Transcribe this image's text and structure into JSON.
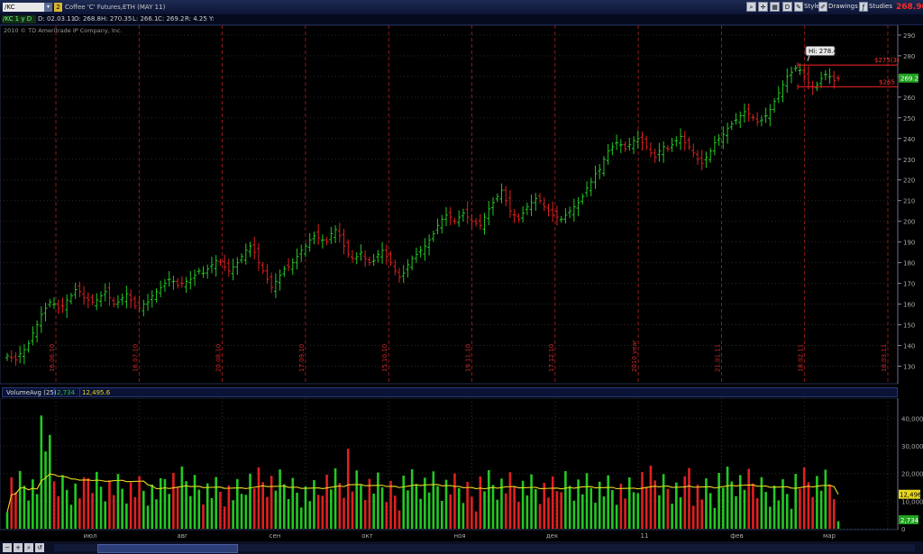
{
  "header": {
    "symbol": "/KC",
    "symbol_dropdown_glyph": "▾",
    "link_number": "2",
    "description": "Coffee 'C' Futures,ETH (MAY 11)",
    "last_price": "268.90",
    "timeframe": "D",
    "toolbar": {
      "style_label": "Style",
      "drawings_label": "Drawings",
      "studies_label": "Studies"
    }
  },
  "quote_info": {
    "label": "/KC 1 y D",
    "date": "D: 02.03.11",
    "open": "O: 268.8",
    "high": "H: 270.35",
    "low": "L: 266.1",
    "close": "C: 269.2",
    "range": "R: 4.25",
    "y": "Y:"
  },
  "copyright": "2010 © TD Ameritrade IP Company, Inc.",
  "annotations": {
    "hi_label": "Hi: 278.4",
    "line1_label": "$275(3)",
    "line2_label": "$265",
    "current_price_label": "269.2"
  },
  "volume_study": {
    "label": "VolumeAvg (25)",
    "value": "2,734",
    "avg": "12,495.6",
    "current_avg_label": "12,496",
    "current_vol_label": "2,734"
  },
  "colors": {
    "up": "#23c823",
    "down": "#e02020",
    "avg": "#e8d820",
    "line": "#e02020",
    "bg": "#000000"
  },
  "chart_data": [
    {
      "type": "candlestick",
      "title": "Coffee 'C' Futures,ETH (MAY 11)",
      "y_ticks": [
        130,
        140,
        150,
        160,
        170,
        180,
        190,
        200,
        210,
        220,
        230,
        240,
        250,
        260,
        270,
        280,
        290
      ],
      "ylim": [
        125,
        293
      ],
      "x_month_labels": [
        "июл",
        "авг",
        "сен",
        "окт",
        "ноя",
        "дек",
        "11",
        "фев",
        "мар"
      ],
      "vertical_date_labels": [
        "16.06.10",
        "16.07.10",
        "20.08.10",
        "17.09.10",
        "15.10.10",
        "19.11.10",
        "17.12.10",
        "2010 year",
        "21.01.11",
        "18.02.11",
        "18.03.11"
      ],
      "horizontal_lines": [
        275.5,
        265
      ],
      "closes": [
        135,
        134,
        133,
        136,
        138,
        141,
        146,
        150,
        155,
        158,
        161,
        160,
        158,
        159,
        162,
        164,
        167,
        166,
        163,
        162,
        161,
        162,
        164,
        166,
        163,
        160,
        161,
        163,
        165,
        162,
        159,
        158,
        160,
        161,
        164,
        166,
        168,
        170,
        172,
        171,
        169,
        170,
        171,
        172,
        174,
        176,
        175,
        177,
        179,
        181,
        180,
        178,
        176,
        178,
        180,
        183,
        186,
        188,
        185,
        180,
        176,
        172,
        168,
        171,
        174,
        177,
        178,
        180,
        183,
        186,
        188,
        191,
        193,
        192,
        191,
        190,
        194,
        196,
        193,
        188,
        184,
        182,
        183,
        185,
        182,
        180,
        181,
        184,
        186,
        183,
        180,
        176,
        173,
        175,
        179,
        182,
        184,
        186,
        188,
        191,
        194,
        198,
        201,
        203,
        202,
        200,
        202,
        204,
        202,
        200,
        199,
        198,
        202,
        206,
        209,
        212,
        215,
        210,
        205,
        203,
        201,
        204,
        207,
        209,
        211,
        210,
        207,
        205,
        203,
        202,
        201,
        203,
        205,
        207,
        209,
        212,
        216,
        219,
        223,
        225,
        230,
        234,
        236,
        238,
        237,
        235,
        237,
        239,
        240,
        238,
        236,
        233,
        231,
        234,
        236,
        235,
        237,
        239,
        241,
        238,
        236,
        233,
        230,
        228,
        231,
        234,
        238,
        240,
        242,
        245,
        247,
        249,
        251,
        253,
        252,
        250,
        248,
        249,
        251,
        254,
        258,
        262,
        266,
        270,
        272,
        274,
        273,
        270,
        267,
        265,
        266,
        269,
        271,
        270,
        268,
        269
      ]
    },
    {
      "type": "bar",
      "title": "VolumeAvg (25)",
      "y_ticks": [
        0,
        10000,
        20000,
        30000,
        40000
      ],
      "y_tick_labels": [
        "0",
        "10,000",
        "20,000",
        "30,000",
        "40,000"
      ],
      "ylim": [
        0,
        46000
      ],
      "avg_last": 12495.6,
      "volume_last": 2734
    }
  ]
}
